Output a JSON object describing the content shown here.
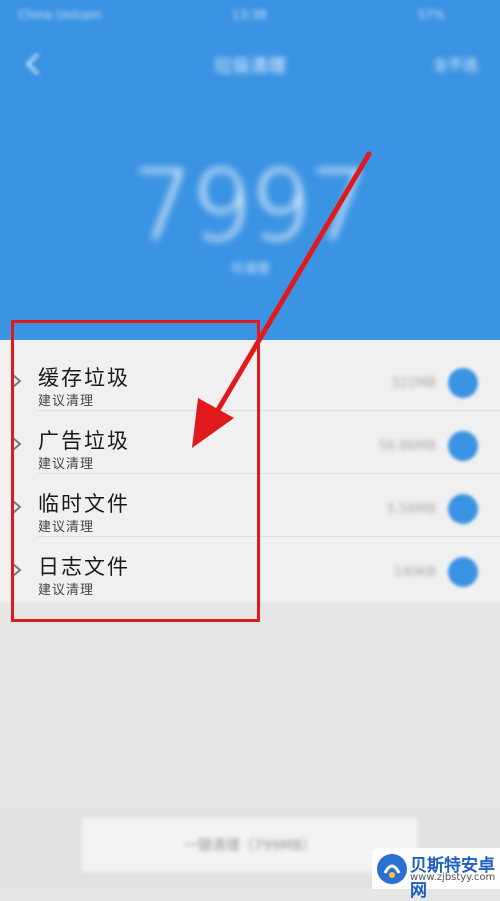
{
  "status_bar": {
    "carrier": "China Unicom",
    "time": "13:38",
    "battery": "57%"
  },
  "header": {
    "title": "垃圾清理",
    "right_action": "全不选",
    "total_number": "7997",
    "total_unit": "可清理"
  },
  "items": [
    {
      "title": "缓存垃圾",
      "subtitle": "建议清理",
      "size": "322MB"
    },
    {
      "title": "广告垃圾",
      "subtitle": "建议清理",
      "size": "56.86MB"
    },
    {
      "title": "临时文件",
      "subtitle": "建议清理",
      "size": "5.56MB"
    },
    {
      "title": "日志文件",
      "subtitle": "建议清理",
      "size": "140KB"
    }
  ],
  "bottom": {
    "clean_button_label": "一键清理（799MB）"
  },
  "watermark": {
    "name": "贝斯特安卓网",
    "url": "www.zjbstyy.com"
  },
  "colors": {
    "header_blue": "#3b93e3",
    "annotation_red": "#e0191d"
  }
}
